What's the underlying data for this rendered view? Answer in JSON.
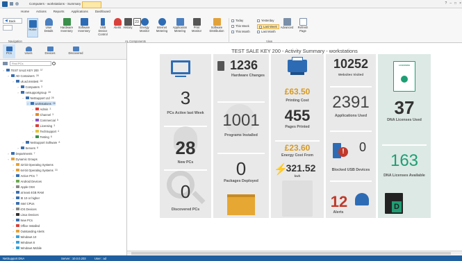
{
  "titlebar": {
    "title": "Computers - workstations - Summary",
    "tabs": [
      "Home",
      "Actions",
      "Reports",
      "Applications",
      "Dashboard"
    ],
    "win_buttons": [
      "?",
      "–",
      "□",
      "×"
    ]
  },
  "ribbon": {
    "buttons": [
      {
        "label": "Home"
      },
      {
        "label": "User Details"
      },
      {
        "label": "Hardware Inventory"
      },
      {
        "label": "Software Inventory"
      },
      {
        "label": "USB Device Control"
      },
      {
        "label": "Alerts"
      },
      {
        "label": "History"
      },
      {
        "label": "Calendar"
      },
      {
        "label": "Energy Monitor"
      },
      {
        "label": "Internet Metering"
      },
      {
        "label": "Application Metering"
      },
      {
        "label": "Print Monitor"
      },
      {
        "label": "Software Distribution"
      }
    ],
    "back_label": "Back",
    "date_filters": [
      "Today",
      "This Week",
      "This Month",
      "Yesterday",
      "Last Week",
      "Last Month"
    ],
    "advanced_label": "Advanced",
    "refresh_label": "Refresh Page",
    "groups": [
      "Navigation",
      "AL Components",
      "View"
    ],
    "colors": {
      "selected_filter": "#fde9a8",
      "accent": "#1f5f9f"
    }
  },
  "leftpanel": {
    "toptabs": [
      "PCs",
      "Users",
      "Devices",
      "Discovered"
    ],
    "search_placeholder": "Find PCs",
    "tree": [
      {
        "label": "TEST SALE KEY 200",
        "count": "37",
        "indent": 0,
        "color": "#3a6fb0"
      },
      {
        "label": "AD Containers",
        "count": "28",
        "indent": 1,
        "color": "#3a6fb0"
      },
      {
        "label": "uk.ad.msstest",
        "count": "28",
        "indent": 2,
        "color": "#3a6fb0"
      },
      {
        "label": "Computers",
        "count": "3",
        "indent": 3,
        "color": "#3a6fb0"
      },
      {
        "label": "netsupportgroup",
        "count": "28",
        "indent": 3,
        "color": "#3a6fb0"
      },
      {
        "label": "NetSupport Ltd",
        "count": "28",
        "indent": 4,
        "color": "#3a6fb0"
      },
      {
        "label": "workstations",
        "count": "26",
        "indent": 5,
        "color": "#3a6fb0",
        "selected": true
      },
      {
        "label": "Admin",
        "count": "3",
        "indent": 6,
        "color": "#d9403a"
      },
      {
        "label": "Channel",
        "count": "3",
        "indent": 6,
        "color": "#e08a2a"
      },
      {
        "label": "Commercial",
        "count": "5",
        "indent": 6,
        "color": "#8a4fc2"
      },
      {
        "label": "Licensing",
        "count": "3",
        "indent": 6,
        "color": "#d9403a"
      },
      {
        "label": "TechSupport",
        "count": "4",
        "indent": 6,
        "color": "#e2c23a"
      },
      {
        "label": "Testing",
        "count": "8",
        "indent": 6,
        "color": "#3a8f4a"
      },
      {
        "label": "NetSupport Software",
        "count": "8",
        "indent": 4,
        "color": "#3a6fb0"
      },
      {
        "label": "Servers",
        "count": "8",
        "indent": 3,
        "color": "#3a6fb0"
      },
      {
        "label": "Departments",
        "count": "7",
        "indent": 1,
        "color": "#3a6fb0"
      },
      {
        "label": "Dynamic Groups",
        "count": "",
        "indent": 1,
        "color": "#e2a23a"
      },
      {
        "label": "32-bit Operating Systems",
        "count": "",
        "indent": 2,
        "color": "#e2a23a"
      },
      {
        "label": "64-bit Operating Systems",
        "count": "33",
        "indent": 2,
        "color": "#e2a23a"
      },
      {
        "label": "Active PCs",
        "count": "3",
        "indent": 2,
        "color": "#3a6fb0"
      },
      {
        "label": "Android Devices",
        "count": "",
        "indent": 2,
        "color": "#6aa84f"
      },
      {
        "label": "Apple OSX",
        "count": "",
        "indent": 2,
        "color": "#888888"
      },
      {
        "label": "at least 4GB RAM",
        "count": "",
        "indent": 2,
        "color": "#3a6fb0"
      },
      {
        "label": "IE 10 or higher",
        "count": "",
        "indent": 2,
        "color": "#3a6fb0"
      },
      {
        "label": "Intel CPUs",
        "count": "",
        "indent": 2,
        "color": "#3a6fb0"
      },
      {
        "label": "iOS Devices",
        "count": "",
        "indent": 2,
        "color": "#888888"
      },
      {
        "label": "Linux Devices",
        "count": "",
        "indent": 2,
        "color": "#333333"
      },
      {
        "label": "New PCs",
        "count": "",
        "indent": 2,
        "color": "#3a6fb0"
      },
      {
        "label": "Office Installed",
        "count": "",
        "indent": 2,
        "color": "#d9403a"
      },
      {
        "label": "Outstanding Alerts",
        "count": "",
        "indent": 2,
        "color": "#e2a23a"
      },
      {
        "label": "Windows 10",
        "count": "",
        "indent": 2,
        "color": "#3a9fd8"
      },
      {
        "label": "Windows 8",
        "count": "",
        "indent": 2,
        "color": "#3a9fd8"
      },
      {
        "label": "Windows Mobile",
        "count": "",
        "indent": 2,
        "color": "#3a9fd8"
      }
    ]
  },
  "main": {
    "title": "TEST SALE KEY 200 - Activity Summary - workstations",
    "tiles": {
      "pcs_active": {
        "value": "3",
        "label": "PCs Active last Week"
      },
      "new_pcs": {
        "value": "28",
        "label": "New PCs"
      },
      "discovered": {
        "value": "0",
        "label": "Discovered PCs"
      },
      "hardware_changes": {
        "value": "1236",
        "label": "Hardware Changes"
      },
      "programs_installed": {
        "value": "1001",
        "label": "Programs Installed"
      },
      "packages_deployed": {
        "value": "0",
        "label": "Packages Deployed"
      },
      "printing_cost": {
        "value": "£63.50",
        "label": "Printing Cost"
      },
      "pages_printed": {
        "value": "455",
        "label": "Pages Printed"
      },
      "energy_cost": {
        "value": "£23.60",
        "label": "Energy Cost From"
      },
      "kwh": {
        "value": "321.52",
        "label": "kwh"
      },
      "websites": {
        "value": "10252",
        "label": "Websites Visited"
      },
      "applications": {
        "value": "2391",
        "label": "Applications Used"
      },
      "blocked_usb": {
        "value": "0",
        "label": "Blocked USB Devices"
      },
      "alerts": {
        "value": "12",
        "label": "Alerts"
      },
      "dna_used": {
        "value": "37",
        "label": "DNA Licenses Used"
      },
      "dna_available": {
        "value": "163",
        "label": "DNA Licenses Available"
      }
    },
    "certificate_text": "LICENSING",
    "colors": {
      "money": "#d99a1e",
      "alert_red": "#d9403a",
      "dna_green": "#1e9e74",
      "icon_blue": "#2d6cb5"
    }
  },
  "statusbar": {
    "left": "NetSupport DNA",
    "server": "Server : 10.0.0.203",
    "user": "User : ad"
  }
}
